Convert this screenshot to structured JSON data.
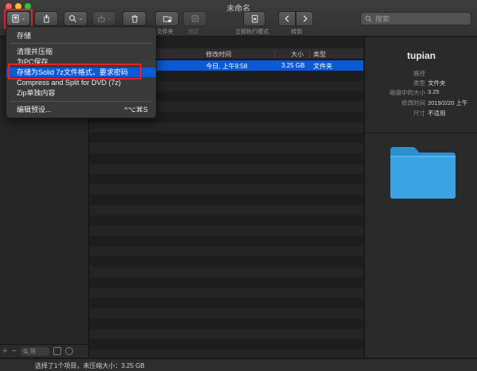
{
  "window": {
    "title": "未命名"
  },
  "toolbar": {
    "labels": {
      "new_folder": "文件夹",
      "test": "测试",
      "immediate_mode": "立即执行模式",
      "goto": "转到"
    },
    "search_placeholder": "搜索"
  },
  "menu": {
    "items": {
      "save": "存储",
      "clean_compress": "清理并压缩",
      "save_pc": "为PC保存",
      "save_solid": "存储为Solid 7z文件格式，要求密码",
      "compress_split": "Compress and Split for DVD (7z)",
      "zip_each": "Zip单独内容",
      "edit_presets": "编辑预设..."
    },
    "edit_presets_shortcut": "^⌥⌘S"
  },
  "file_list": {
    "columns": {
      "modified": "修改时间",
      "size": "大小",
      "kind": "类型"
    },
    "rows": [
      {
        "modified": "今日, 上午9:58",
        "size": "3.25 GB",
        "kind": "文件夹",
        "selected": true
      }
    ]
  },
  "inspector": {
    "name": "tupian",
    "properties": [
      {
        "key": "路径",
        "value": ""
      },
      {
        "key": "类型",
        "value": "文件夹"
      },
      {
        "key": "磁盘中的大小",
        "value": "3.25"
      },
      {
        "key": "修改时间",
        "value": "2019/2/20 上午"
      },
      {
        "key": "尺寸",
        "value": "不适用"
      }
    ],
    "folder_color": "#3aa3e3"
  },
  "sidebar": {
    "search_placeholder": "搜"
  },
  "status": {
    "text": "选择了1个项目，未压缩大小：3.25 GB"
  },
  "colors": {
    "accent": "#0b59d4",
    "highlight_box": "#e0232f"
  }
}
